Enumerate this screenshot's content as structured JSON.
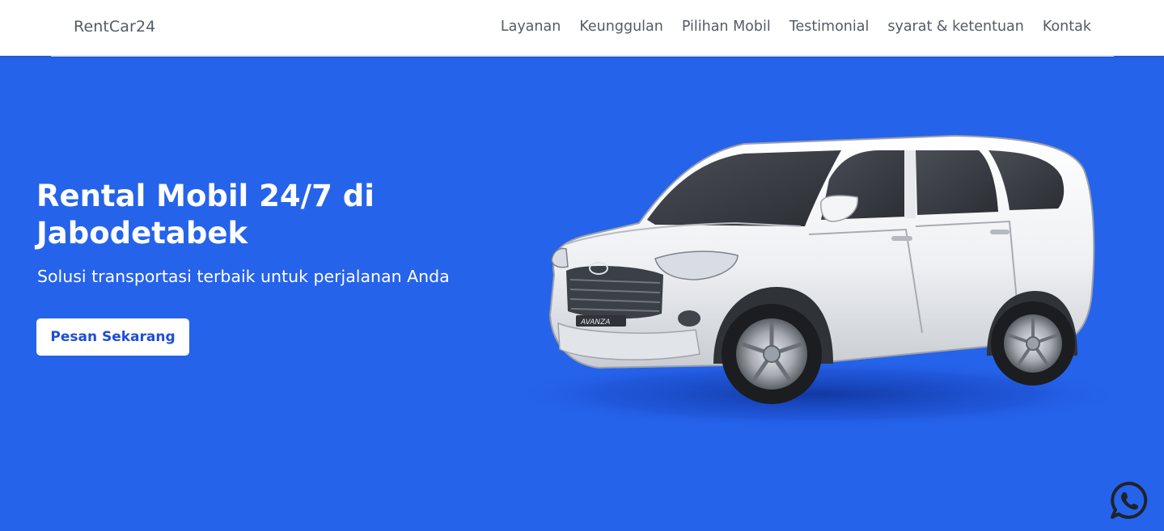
{
  "brand": "RentCar24",
  "nav": {
    "items": [
      {
        "label": "Layanan"
      },
      {
        "label": "Keunggulan"
      },
      {
        "label": "Pilihan Mobil"
      },
      {
        "label": "Testimonial"
      },
      {
        "label": "syarat & ketentuan"
      },
      {
        "label": "Kontak"
      }
    ]
  },
  "hero": {
    "title": "Rental Mobil 24/7 di Jabodetabek",
    "subtitle": "Solusi transportasi terbaik untuk perjalanan Anda",
    "cta_label": "Pesan Sekarang",
    "car_badge": "AVANZA"
  },
  "colors": {
    "hero_bg": "#2563eb",
    "nav_text": "#555b63",
    "cta_text": "#1d4ed8"
  },
  "icons": {
    "whatsapp": "whatsapp-icon",
    "car": "car-illustration"
  }
}
